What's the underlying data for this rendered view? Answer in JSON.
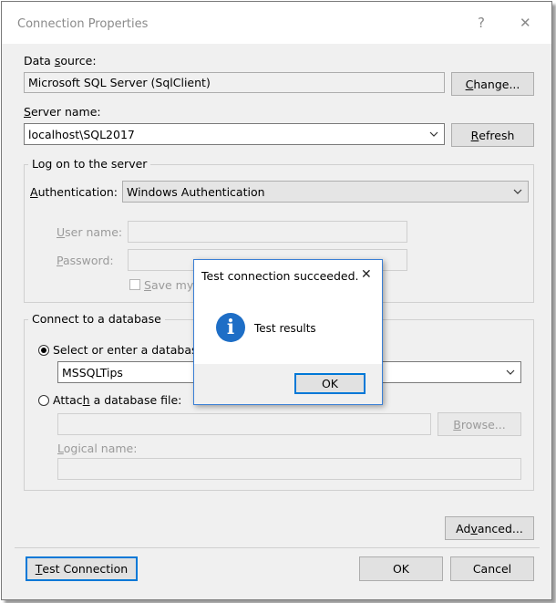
{
  "window": {
    "title": "Connection Properties",
    "help_glyph": "?",
    "close_glyph": "✕"
  },
  "data_source": {
    "label_pre": "Data ",
    "label_u": "s",
    "label_post": "ource:",
    "value": "Microsoft SQL Server (SqlClient)",
    "change_pre": "",
    "change_u": "C",
    "change_post": "hange..."
  },
  "server": {
    "label_pre": "",
    "label_u": "S",
    "label_post": "erver name:",
    "value": "localhost\\SQL2017",
    "refresh_pre": "",
    "refresh_u": "R",
    "refresh_post": "efresh"
  },
  "logon": {
    "group_title": "Log on to the server",
    "auth_label_pre": "",
    "auth_label_u": "A",
    "auth_label_post": "uthentication:",
    "auth_value": "Windows Authentication",
    "username_pre": "",
    "username_u": "U",
    "username_post": "ser name:",
    "password_pre": "",
    "password_u": "P",
    "password_post": "assword:",
    "save_pre": "",
    "save_u": "S",
    "save_post": "ave my p"
  },
  "database": {
    "group_title": "Connect to a database",
    "select_label": "Select or enter a database n",
    "db_value": "MSSQLTips",
    "attach_pre": "Attac",
    "attach_u": "h",
    "attach_post": " a database file:",
    "browse_pre": "",
    "browse_u": "B",
    "browse_post": "rowse...",
    "logical_pre": "",
    "logical_u": "L",
    "logical_post": "ogical name:"
  },
  "advanced": {
    "pre": "Ad",
    "u": "v",
    "post": "anced..."
  },
  "footer": {
    "test_pre": "",
    "test_u": "T",
    "test_post": "est Connection",
    "ok": "OK",
    "cancel": "Cancel"
  },
  "popup": {
    "title": "Test connection succeeded.",
    "close_glyph": "✕",
    "icon_glyph": "i",
    "message": "Test results",
    "ok": "OK"
  },
  "colors": {
    "accent": "#0078d7",
    "info_icon": "#1e6ec6"
  },
  "icons": {
    "combo": "chevron-down-icon",
    "info": "info-icon"
  }
}
